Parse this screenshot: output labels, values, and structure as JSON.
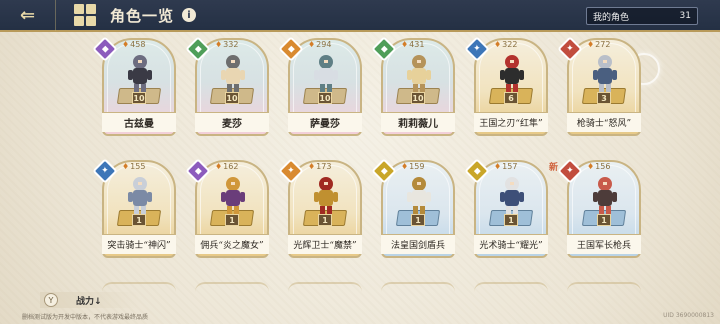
{
  "header": {
    "back_label": "⇐",
    "title": "角色一览",
    "info_label": "i",
    "my_characters_label": "我的角色",
    "my_characters_count": "31"
  },
  "cards": [
    {
      "name": "古兹曼",
      "power": "458",
      "level": "10",
      "element": "purple",
      "element_glyph": "◆",
      "theme": "pink"
    },
    {
      "name": "麦莎",
      "power": "332",
      "level": "10",
      "element": "green",
      "element_glyph": "◆",
      "theme": "pink"
    },
    {
      "name": "萨曼莎",
      "power": "294",
      "level": "10",
      "element": "orange",
      "element_glyph": "◆",
      "theme": "pink"
    },
    {
      "name": "莉莉薇儿",
      "power": "431",
      "level": "10",
      "element": "green",
      "element_glyph": "◆",
      "theme": "pink"
    },
    {
      "name": "王国之刃“红隼”",
      "power": "322",
      "level": "6",
      "element": "blue",
      "element_glyph": "✦",
      "theme": "gold"
    },
    {
      "name": "枪骑士“怒风”",
      "power": "272",
      "level": "3",
      "element": "red",
      "element_glyph": "✦",
      "theme": "gold"
    },
    {
      "name": "突击骑士“神闪”",
      "power": "155",
      "level": "1",
      "element": "blue",
      "element_glyph": "✦",
      "theme": "gold"
    },
    {
      "name": "佣兵“炎之魔女”",
      "power": "162",
      "level": "1",
      "element": "purple",
      "element_glyph": "◆",
      "theme": "gold"
    },
    {
      "name": "光辉卫士“魔禁”",
      "power": "173",
      "level": "1",
      "element": "orange",
      "element_glyph": "✦",
      "theme": "gold"
    },
    {
      "name": "法皇国剑盾兵",
      "power": "159",
      "level": "1",
      "element": "yellow",
      "element_glyph": "◆",
      "theme": "blue"
    },
    {
      "name": "光术骑士“耀光”",
      "power": "157",
      "level": "1",
      "element": "yellow",
      "element_glyph": "◆",
      "theme": "blue",
      "new": "新"
    },
    {
      "name": "王国军长枪兵",
      "power": "156",
      "level": "1",
      "element": "red",
      "element_glyph": "✦",
      "theme": "blue"
    }
  ],
  "footer": {
    "power_label": "战力↓",
    "power_icon": "Y",
    "disclaimer": "删档测试版为开发中版本，不代表游戏最终品质",
    "uid": "UID 3690000813"
  },
  "colors": {
    "header_bg": "#2f3a4f",
    "gold_border": "#c9b483",
    "accent_power": "#d47d27"
  }
}
